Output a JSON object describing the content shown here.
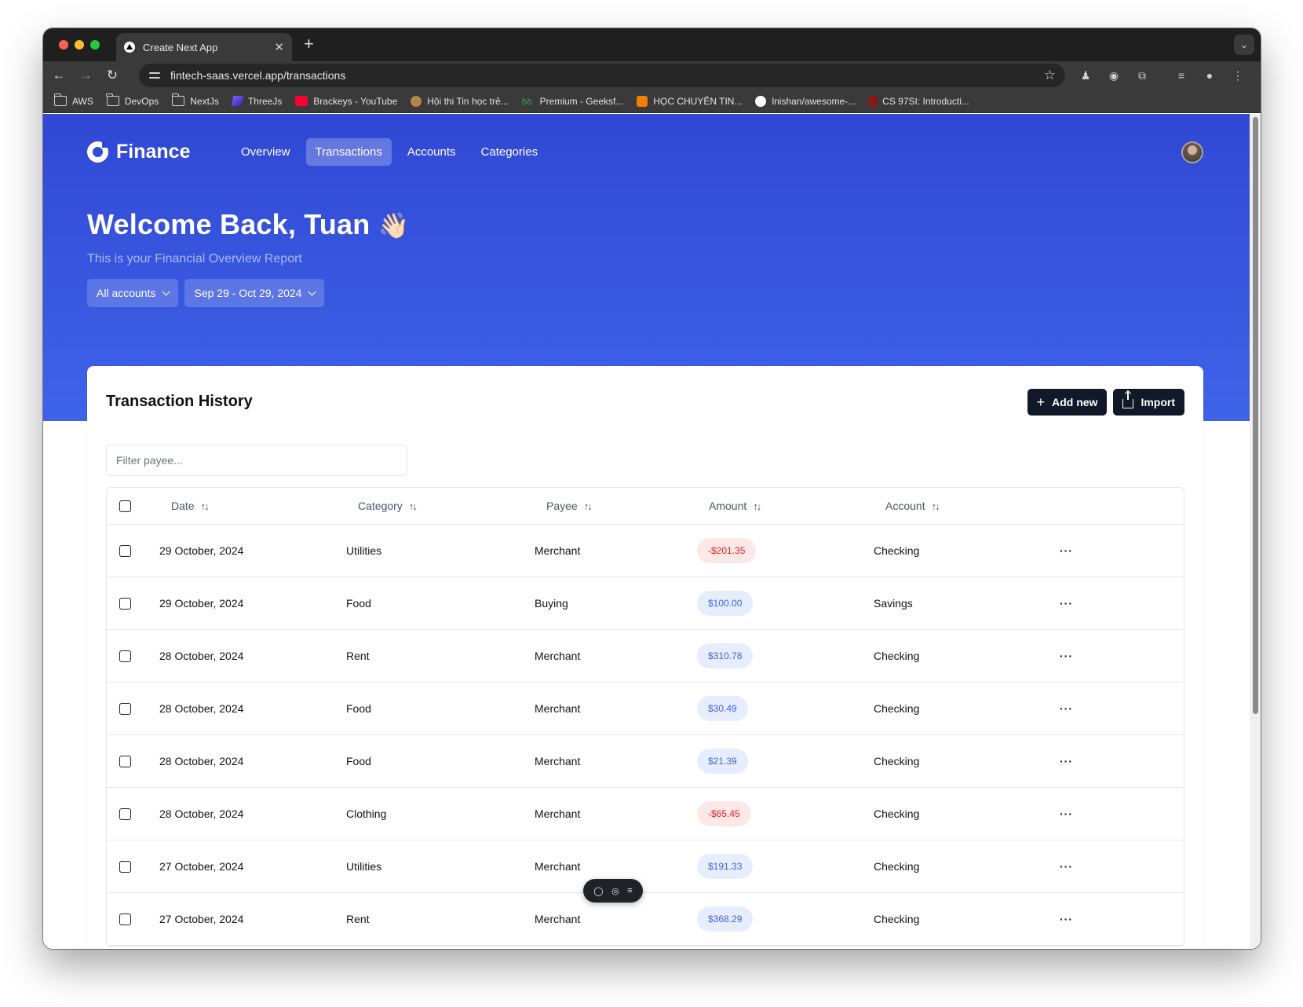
{
  "browser": {
    "tab_title": "Create Next App",
    "tab_close": "✕",
    "new_tab": "+",
    "tab_search": "⌄",
    "url": "fintech-saas.vercel.app/transactions",
    "bookmarks": [
      {
        "label": "AWS",
        "icon": "folder-icon"
      },
      {
        "label": "DevOps",
        "icon": "folder-icon"
      },
      {
        "label": "NextJs",
        "icon": "folder-icon"
      },
      {
        "label": "ThreeJs",
        "icon": "threejs-icon"
      },
      {
        "label": "Brackeys - YouTube",
        "icon": "youtube-icon"
      },
      {
        "label": "Hội thi Tin học trẻ...",
        "icon": "site-icon"
      },
      {
        "label": "Premium - Geeksf...",
        "icon": "geeksforgeeks-icon"
      },
      {
        "label": "HỌC CHUYÊN TIN...",
        "icon": "blogger-icon"
      },
      {
        "label": "lnishan/awesome-...",
        "icon": "github-icon"
      },
      {
        "label": "CS 97SI: Introducti...",
        "icon": "stanford-icon"
      }
    ]
  },
  "app": {
    "brand": "Finance",
    "nav": [
      {
        "label": "Overview",
        "active": false
      },
      {
        "label": "Transactions",
        "active": true
      },
      {
        "label": "Accounts",
        "active": false
      },
      {
        "label": "Categories",
        "active": false
      }
    ],
    "welcome": "Welcome Back, Tuan",
    "wave_emoji": "👋🏻",
    "subtitle": "This is your Financial Overview Report",
    "account_filter": "All accounts",
    "date_filter": "Sep 29 - Oct 29, 2024"
  },
  "card": {
    "title": "Transaction History",
    "add_new": "Add new",
    "import": "Import",
    "filter_placeholder": "Filter payee...",
    "columns": [
      "Date",
      "Category",
      "Payee",
      "Amount",
      "Account"
    ],
    "sort_glyph": "↑↓",
    "more_glyph": "···",
    "rows": [
      {
        "date": "29 October, 2024",
        "category": "Utilities",
        "payee": "Merchant",
        "amount": "-$201.35",
        "negative": true,
        "account": "Checking"
      },
      {
        "date": "29 October, 2024",
        "category": "Food",
        "payee": "Buying",
        "amount": "$100.00",
        "negative": false,
        "account": "Savings"
      },
      {
        "date": "28 October, 2024",
        "category": "Rent",
        "payee": "Merchant",
        "amount": "$310.78",
        "negative": false,
        "account": "Checking"
      },
      {
        "date": "28 October, 2024",
        "category": "Food",
        "payee": "Merchant",
        "amount": "$30.49",
        "negative": false,
        "account": "Checking"
      },
      {
        "date": "28 October, 2024",
        "category": "Food",
        "payee": "Merchant",
        "amount": "$21.39",
        "negative": false,
        "account": "Checking"
      },
      {
        "date": "28 October, 2024",
        "category": "Clothing",
        "payee": "Merchant",
        "amount": "-$65.45",
        "negative": true,
        "account": "Checking"
      },
      {
        "date": "27 October, 2024",
        "category": "Utilities",
        "payee": "Merchant",
        "amount": "$191.33",
        "negative": false,
        "account": "Checking"
      },
      {
        "date": "27 October, 2024",
        "category": "Rent",
        "payee": "Merchant",
        "amount": "$368.29",
        "negative": false,
        "account": "Checking"
      }
    ]
  },
  "colors": {
    "hero_top": "#3048d4",
    "hero_bottom": "#3f63e8",
    "negative_text": "#e02424",
    "negative_bg": "#fde8e8",
    "positive_text": "#3f63e8",
    "positive_bg": "#e6edfd",
    "button_dark": "#111827"
  }
}
